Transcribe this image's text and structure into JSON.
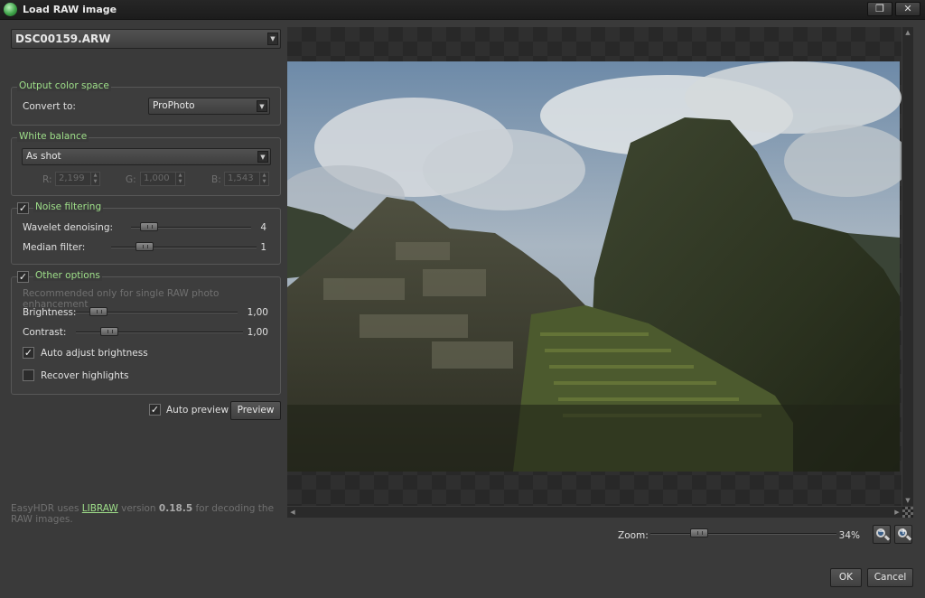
{
  "window": {
    "title": "Load RAW image",
    "restore_glyph": "❐",
    "close_glyph": "✕"
  },
  "file": {
    "selected": "DSC00159.ARW"
  },
  "output_color_space": {
    "title": "Output color space",
    "convert_label": "Convert to:",
    "convert_value": "ProPhoto"
  },
  "white_balance": {
    "title": "White balance",
    "mode": "As shot",
    "r_label": "R:",
    "r_value": "2,199",
    "g_label": "G:",
    "g_value": "1,000",
    "b_label": "B:",
    "b_value": "1,543"
  },
  "noise_filtering": {
    "title": "Noise filtering",
    "checked": true,
    "wavelet_label": "Wavelet denoising:",
    "wavelet_value": "4",
    "median_label": "Median filter:",
    "median_value": "1"
  },
  "other_options": {
    "title": "Other options",
    "checked": true,
    "hint": "Recommended only for single RAW photo enhancement",
    "brightness_label": "Brightness:",
    "brightness_value": "1,00",
    "contrast_label": "Contrast:",
    "contrast_value": "1,00",
    "auto_adjust_label": "Auto adjust brightness",
    "auto_adjust_checked": true,
    "recover_label": "Recover highlights",
    "recover_checked": false
  },
  "preview_controls": {
    "auto_preview_label": "Auto preview",
    "auto_preview_checked": true,
    "preview_button": "Preview"
  },
  "footer": {
    "prefix": "EasyHDR uses ",
    "link": "LIBRAW",
    "middle": " version ",
    "version": "0.18.5",
    "suffix": " for decoding the RAW images."
  },
  "zoom": {
    "label": "Zoom:",
    "value": "34%"
  },
  "dialog_buttons": {
    "ok": "OK",
    "cancel": "Cancel"
  },
  "icons": {
    "checkmark": "✓",
    "dropdown_arrow": "▼",
    "arrow_up": "▲",
    "arrow_down": "▼",
    "arrow_left": "◀",
    "arrow_right": "▶",
    "zoom_out_sign": "−",
    "zoom_in_sign": "+"
  }
}
